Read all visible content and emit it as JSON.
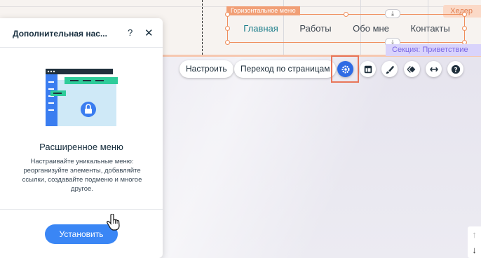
{
  "header": {
    "tag": "Хедер",
    "section_tag": "Секция: Приветствие"
  },
  "menu": {
    "label": "Горизонтальное меню",
    "items": [
      {
        "label": "Главная",
        "active": true
      },
      {
        "label": "Работы",
        "active": false
      },
      {
        "label": "Обо мне",
        "active": false
      },
      {
        "label": "Контакты",
        "active": false
      }
    ]
  },
  "toolbar": {
    "customize_label": "Настроить",
    "navigate_label": "Переход по страницам",
    "icons": [
      "settings-icon",
      "layout-icon",
      "design-brush-icon",
      "animation-icon",
      "stretch-icon",
      "help-icon"
    ],
    "accent_color": "#2f6be4",
    "highlight_color": "#e8765a"
  },
  "panel": {
    "title": "Дополнительная нас...",
    "help": "?",
    "close": "✕",
    "heading": "Расширенное меню",
    "description": "Настраивайте уникальные меню: реорганизуйте элементы, добавляйте ссылки, создавайте подменю и многое другое.",
    "install_label": "Установить"
  },
  "scroll": {
    "up": "↑",
    "down": "↓"
  }
}
